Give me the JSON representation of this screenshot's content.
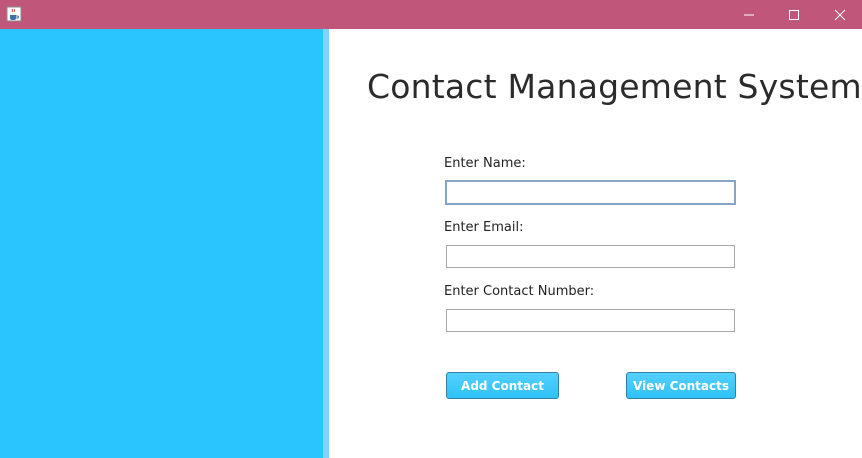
{
  "window": {
    "title": "",
    "app_icon": "java-cup-icon",
    "titlebar_color": "#c0577a"
  },
  "sidebar": {
    "color": "#2ac4ff"
  },
  "main": {
    "title": "Contact Management System",
    "form": {
      "name_label": "Enter Name:",
      "name_value": "",
      "email_label": "Enter Email:",
      "email_value": "",
      "contact_label": "Enter Contact Number:",
      "contact_value": ""
    },
    "buttons": {
      "add_label": "Add Contact",
      "view_label": "View Contacts",
      "color": "#2ec2f7"
    }
  }
}
